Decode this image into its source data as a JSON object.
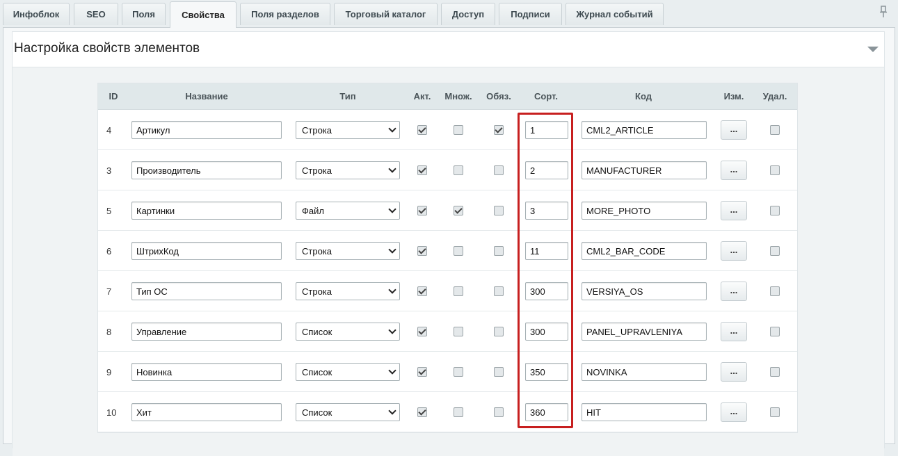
{
  "tabs": [
    {
      "label": "Инфоблок"
    },
    {
      "label": "SEO"
    },
    {
      "label": "Поля"
    },
    {
      "label": "Свойства",
      "active": true
    },
    {
      "label": "Поля разделов"
    },
    {
      "label": "Торговый каталог"
    },
    {
      "label": "Доступ"
    },
    {
      "label": "Подписи"
    },
    {
      "label": "Журнал событий"
    }
  ],
  "panel": {
    "title": "Настройка свойств элементов"
  },
  "table": {
    "headers": {
      "id": "ID",
      "name": "Название",
      "type": "Тип",
      "active": "Акт.",
      "multiple": "Множ.",
      "required": "Обяз.",
      "sort": "Сорт.",
      "code": "Код",
      "edit": "Изм.",
      "delete": "Удал."
    },
    "edit_button_label": "...",
    "rows": [
      {
        "id": "4",
        "name": "Артикул",
        "type": "Строка",
        "active": true,
        "multiple": false,
        "required": true,
        "sort": "1",
        "code": "CML2_ARTICLE",
        "delete": false
      },
      {
        "id": "3",
        "name": "Производитель",
        "type": "Строка",
        "active": true,
        "multiple": false,
        "required": false,
        "sort": "2",
        "code": "MANUFACTURER",
        "delete": false
      },
      {
        "id": "5",
        "name": "Картинки",
        "type": "Файл",
        "active": true,
        "multiple": true,
        "required": false,
        "sort": "3",
        "code": "MORE_PHOTO",
        "delete": false
      },
      {
        "id": "6",
        "name": "ШтрихКод",
        "type": "Строка",
        "active": true,
        "multiple": false,
        "required": false,
        "sort": "11",
        "code": "CML2_BAR_CODE",
        "delete": false
      },
      {
        "id": "7",
        "name": "Тип ОС",
        "type": "Строка",
        "active": true,
        "multiple": false,
        "required": false,
        "sort": "300",
        "code": "VERSIYA_OS",
        "delete": false
      },
      {
        "id": "8",
        "name": "Управление",
        "type": "Список",
        "active": true,
        "multiple": false,
        "required": false,
        "sort": "300",
        "code": "PANEL_UPRAVLENIYA",
        "delete": false
      },
      {
        "id": "9",
        "name": "Новинка",
        "type": "Список",
        "active": true,
        "multiple": false,
        "required": false,
        "sort": "350",
        "code": "NOVINKA",
        "delete": false
      },
      {
        "id": "10",
        "name": "Хит",
        "type": "Список",
        "active": true,
        "multiple": false,
        "required": false,
        "sort": "360",
        "code": "HIT",
        "delete": false
      }
    ]
  },
  "colors": {
    "highlight": "#c71f1f",
    "header_bg": "#e0e8ea"
  }
}
